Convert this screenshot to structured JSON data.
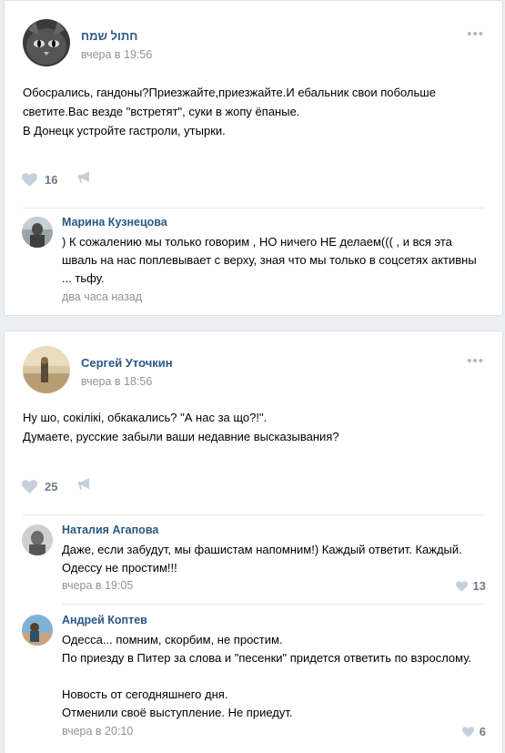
{
  "posts": [
    {
      "author": "חתול שמח",
      "time": "вчера в 19:56",
      "text_lines": [
        "Обосрались, гандоны?Приезжайте,приезжайте.И ебальник свои побольше",
        "светите.Вас везде \"встретят\", суки в жопу ёпаные.",
        "В Донецк устройте гастроли, утырки."
      ],
      "likes": "16",
      "comments": [
        {
          "author": "Марина Кузнецова",
          "text_lines": [
            ") К сожалению мы только говорим , НО ничего НЕ делаем((( , и вся эта",
            "шваль на нас поплевывает с верху, зная что мы только в соцсетях активны",
            "... тьфу."
          ],
          "time": "два часа назад"
        }
      ]
    },
    {
      "author": "Сергей Уточкин",
      "time": "вчера в 18:56",
      "text_lines": [
        "Ну шо, сокілікі, обкакались? \"А нас за що?!\".",
        "Думаете, русские забыли ваши недавние высказывания?"
      ],
      "likes": "25",
      "comments": [
        {
          "author": "Наталия Агапова",
          "text_lines": [
            "Даже, если забудут, мы фашистам напомним!) Каждый ответит. Каждый.",
            "Одессу не простим!!!"
          ],
          "time": "вчера в 19:05",
          "likes": "13"
        },
        {
          "author": "Андрей Коптев",
          "text_lines": [
            "Одесса... помним, скорбим, не простим.",
            "По приезду в Питер за слова и \"песенки\" придется ответить по взрослому.",
            "",
            "Новость от сегодняшнего дня.",
            "Отменили своё выступление. Не приедут."
          ],
          "time": "вчера в 20:10",
          "likes": "6"
        }
      ]
    }
  ],
  "icons": {
    "more": "more-dots-icon",
    "like": "heart-icon",
    "share": "megaphone-share-icon"
  },
  "colors": {
    "link": "#2a5885",
    "muted": "#939393",
    "icon": "#c5d0db",
    "background": "#edeef0"
  }
}
